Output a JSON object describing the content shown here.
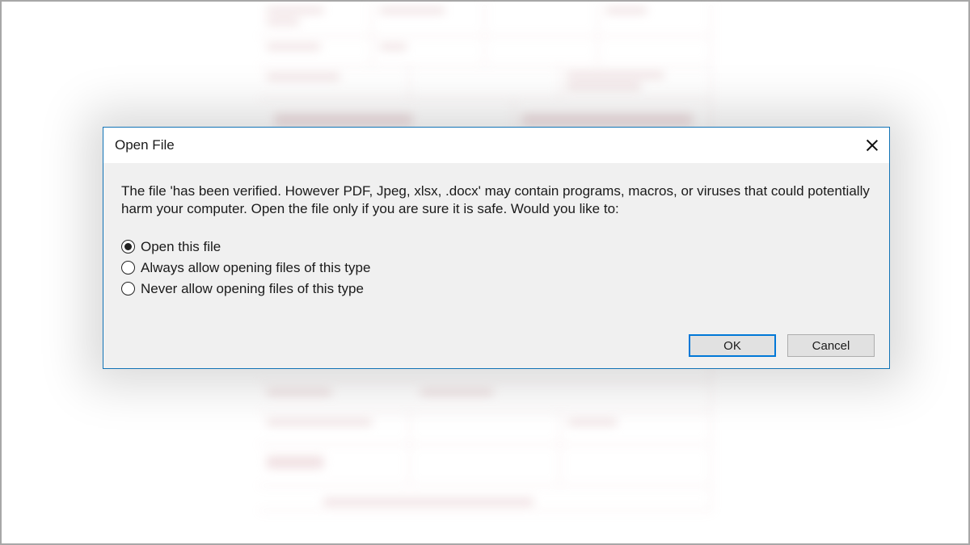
{
  "dialog": {
    "title": "Open File",
    "message": "The file 'has been verified. However PDF, Jpeg, xlsx, .docx' may contain programs, macros, or viruses that could potentially harm your computer. Open the file only if you are sure it is safe. Would you like to:",
    "options": {
      "open": "Open this file",
      "always": "Always allow opening files of this type",
      "never": "Never allow opening files of this type"
    },
    "selected": "open",
    "buttons": {
      "ok": "OK",
      "cancel": "Cancel"
    }
  }
}
